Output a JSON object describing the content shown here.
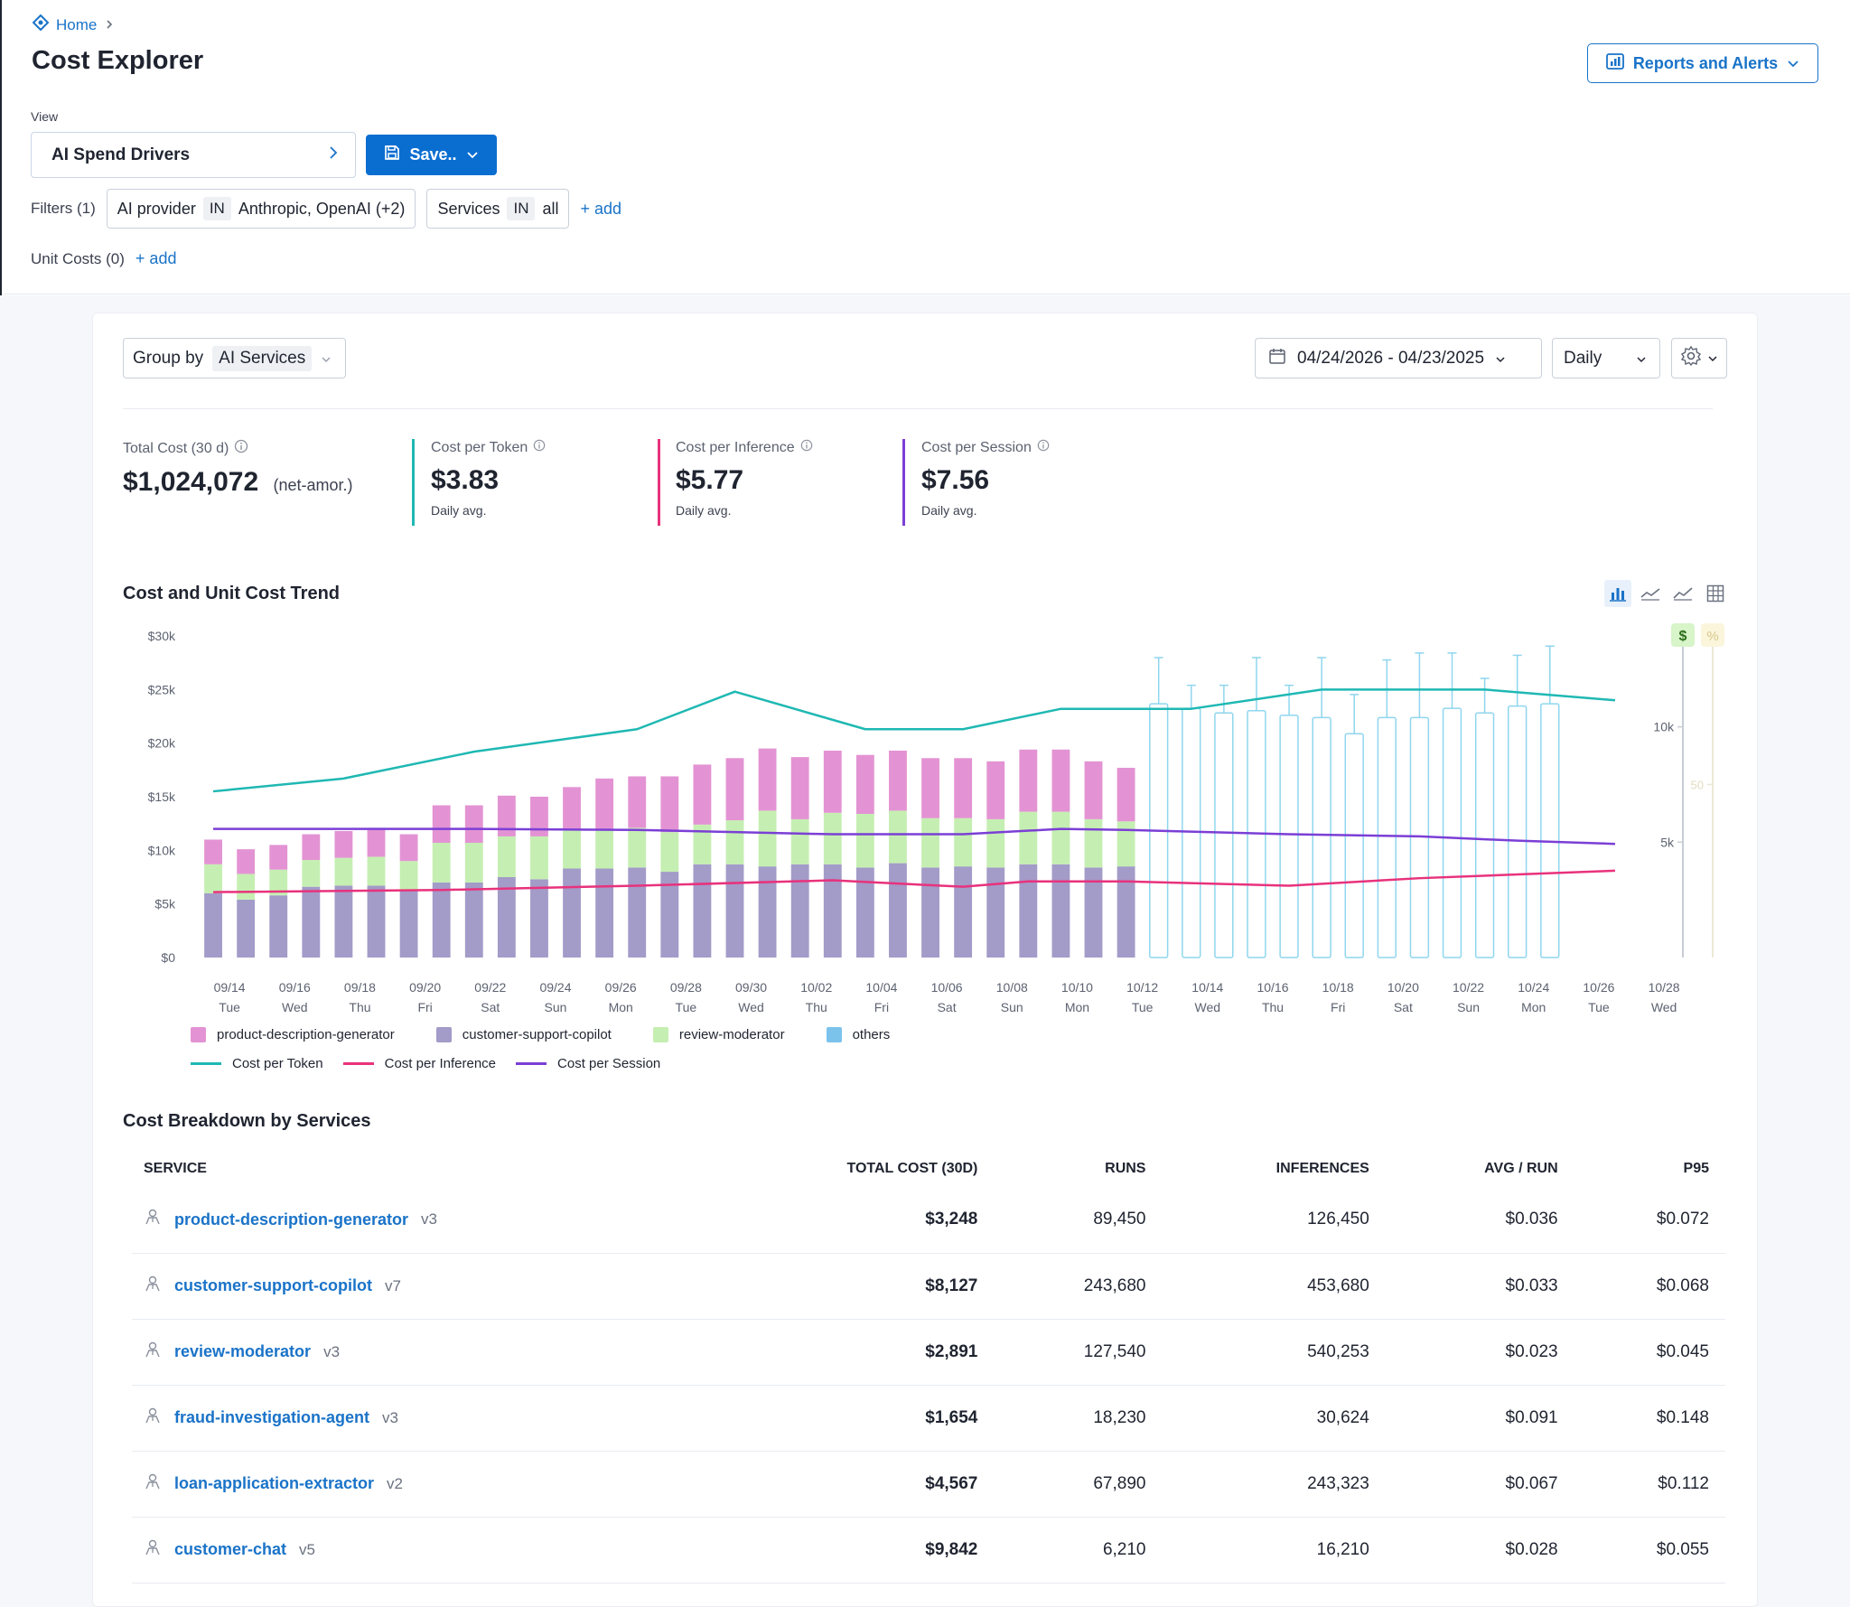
{
  "breadcrumb": {
    "home": "Home"
  },
  "page_title": "Cost Explorer",
  "reports_button": "Reports and Alerts",
  "view": {
    "label": "View",
    "selected": "AI Spend Drivers",
    "save_label": "Save.."
  },
  "filters": {
    "label": "Filters (1)",
    "chips": [
      {
        "field": "AI provider",
        "op": "IN",
        "value": "Anthropic, OpenAI (+2)"
      },
      {
        "field": "Services",
        "op": "IN",
        "value": "all"
      }
    ],
    "add_label": "+ add"
  },
  "unit_costs": {
    "label": "Unit Costs (0)",
    "add_label": "+ add"
  },
  "controls": {
    "group_by_label": "Group by",
    "group_by_value": "AI Services",
    "date_range": "04/24/2026 - 04/23/2025",
    "granularity": "Daily"
  },
  "kpis": [
    {
      "label": "Total Cost (30 d)",
      "value": "$1,024,072",
      "suffix": "(net-amor.)",
      "sub": "",
      "color": ""
    },
    {
      "label": "Cost per Token",
      "value": "$3.83",
      "suffix": "",
      "sub": "Daily avg.",
      "color": "#1fb8b3"
    },
    {
      "label": "Cost per Inference",
      "value": "$5.77",
      "suffix": "",
      "sub": "Daily avg.",
      "color": "#e8327c"
    },
    {
      "label": "Cost per Session",
      "value": "$7.56",
      "suffix": "",
      "sub": "Daily avg.",
      "color": "#7b3fd6"
    }
  ],
  "trend_title": "Cost and Unit Cost Trend",
  "chart_toggle": {
    "dollar": "$",
    "percent": "%"
  },
  "chart_data": {
    "type": "bar",
    "title": "Cost and Unit Cost Trend",
    "y_ticks": [
      "$0",
      "$5k",
      "$10k",
      "$15k",
      "$20k",
      "$25k",
      "$30k"
    ],
    "ylim": [
      0,
      30000
    ],
    "right_ticks": [
      "10k",
      "5k"
    ],
    "right_mid_tick": "50",
    "right_ylim": [
      0,
      13000
    ],
    "x_labels": [
      {
        "date": "09/14",
        "day": "Tue"
      },
      {
        "date": "09/16",
        "day": "Wed"
      },
      {
        "date": "09/18",
        "day": "Thu"
      },
      {
        "date": "09/20",
        "day": "Fri"
      },
      {
        "date": "09/22",
        "day": "Sat"
      },
      {
        "date": "09/24",
        "day": "Sun"
      },
      {
        "date": "09/26",
        "day": "Mon"
      },
      {
        "date": "09/28",
        "day": "Tue"
      },
      {
        "date": "09/30",
        "day": "Wed"
      },
      {
        "date": "10/02",
        "day": "Thu"
      },
      {
        "date": "10/04",
        "day": "Fri"
      },
      {
        "date": "10/06",
        "day": "Sat"
      },
      {
        "date": "10/08",
        "day": "Sun"
      },
      {
        "date": "10/10",
        "day": "Mon"
      },
      {
        "date": "10/12",
        "day": "Tue"
      },
      {
        "date": "10/14",
        "day": "Wed"
      },
      {
        "date": "10/16",
        "day": "Thu"
      },
      {
        "date": "10/18",
        "day": "Fri"
      },
      {
        "date": "10/20",
        "day": "Sat"
      },
      {
        "date": "10/22",
        "day": "Sun"
      },
      {
        "date": "10/24",
        "day": "Mon"
      },
      {
        "date": "10/26",
        "day": "Tue"
      },
      {
        "date": "10/28",
        "day": "Wed"
      }
    ],
    "stack_series": [
      {
        "name": "customer-support-copilot",
        "color": "#a39bc8",
        "values": [
          6000,
          5400,
          5800,
          6600,
          6700,
          6700,
          6300,
          7000,
          7000,
          7500,
          7300,
          8300,
          8300,
          8400,
          8000,
          8700,
          8700,
          8500,
          8700,
          8700,
          8400,
          8800,
          8400,
          8500,
          8400,
          8700,
          8700,
          8400,
          8500
        ]
      },
      {
        "name": "review-moderator",
        "color": "#c5efb2",
        "values": [
          2700,
          2400,
          2400,
          2500,
          2600,
          2700,
          2700,
          3700,
          3700,
          3800,
          4000,
          3600,
          3600,
          3700,
          3700,
          3700,
          4100,
          5200,
          4200,
          4800,
          5000,
          4900,
          4600,
          4500,
          4500,
          4900,
          4900,
          4500,
          4200
        ]
      },
      {
        "name": "product-description-generator",
        "color": "#e393d3",
        "values": [
          2300,
          2300,
          2300,
          2400,
          2500,
          2700,
          2500,
          3500,
          3500,
          3800,
          3700,
          4000,
          4800,
          4800,
          5200,
          5600,
          5800,
          5800,
          5800,
          5800,
          5500,
          5600,
          5600,
          5600,
          5400,
          5800,
          5800,
          5400,
          5000
        ]
      }
    ],
    "forecast_bars": [
      {
        "low": 11000,
        "high": 13000
      },
      {
        "low": 10800,
        "high": 11800
      },
      {
        "low": 10600,
        "high": 11800
      },
      {
        "low": 10700,
        "high": 13000
      },
      {
        "low": 10500,
        "high": 11800
      },
      {
        "low": 10400,
        "high": 13000
      },
      {
        "low": 9700,
        "high": 11400
      },
      {
        "low": 10400,
        "high": 12900
      },
      {
        "low": 10400,
        "high": 13200
      },
      {
        "low": 10800,
        "high": 13200
      },
      {
        "low": 10600,
        "high": 12100
      },
      {
        "low": 10900,
        "high": 13100
      },
      {
        "low": 11000,
        "high": 13500
      }
    ],
    "line_series": [
      {
        "name": "Cost per Token",
        "color": "#1fb8b3",
        "points": [
          [
            0,
            15500
          ],
          [
            4,
            16700
          ],
          [
            8,
            19200
          ],
          [
            13,
            21300
          ],
          [
            16,
            24800
          ],
          [
            20,
            21300
          ],
          [
            23,
            21300
          ],
          [
            26,
            23200
          ],
          [
            28,
            23200
          ],
          [
            30,
            23200
          ],
          [
            34,
            25000
          ],
          [
            36,
            25000
          ],
          [
            39,
            25000
          ],
          [
            43,
            24000
          ]
        ]
      },
      {
        "name": "Cost per Inference",
        "color": "#e8327c",
        "points": [
          [
            0,
            6100
          ],
          [
            7,
            6300
          ],
          [
            13,
            6700
          ],
          [
            19,
            7200
          ],
          [
            21,
            6900
          ],
          [
            23,
            6600
          ],
          [
            25,
            7100
          ],
          [
            28,
            7100
          ],
          [
            33,
            6700
          ],
          [
            37,
            7400
          ],
          [
            43,
            8100
          ]
        ]
      },
      {
        "name": "Cost per Session",
        "color": "#7b3fd6",
        "points": [
          [
            0,
            12000
          ],
          [
            8,
            12000
          ],
          [
            13,
            11900
          ],
          [
            19,
            11500
          ],
          [
            21,
            11500
          ],
          [
            23,
            11500
          ],
          [
            26,
            12000
          ],
          [
            28,
            11900
          ],
          [
            33,
            11500
          ],
          [
            37,
            11300
          ],
          [
            40,
            10900
          ],
          [
            43,
            10600
          ]
        ]
      }
    ],
    "legend": [
      {
        "label": "product-description-generator",
        "color": "#e393d3",
        "kind": "box"
      },
      {
        "label": "customer-support-copilot",
        "color": "#a39bc8",
        "kind": "box"
      },
      {
        "label": "review-moderator",
        "color": "#c5efb2",
        "kind": "box"
      },
      {
        "label": "others",
        "color": "#7cc3ec",
        "kind": "box"
      },
      {
        "label": "Cost per Token",
        "color": "#1fb8b3",
        "kind": "line"
      },
      {
        "label": "Cost per Inference",
        "color": "#e8327c",
        "kind": "line"
      },
      {
        "label": "Cost per Session",
        "color": "#7b3fd6",
        "kind": "line"
      }
    ]
  },
  "breakdown": {
    "title": "Cost Breakdown by Services",
    "columns": [
      "SERVICE",
      "TOTAL COST (30D)",
      "RUNS",
      "INFERENCES",
      "AVG / RUN",
      "P95"
    ],
    "rows": [
      {
        "name": "product-description-generator",
        "version": "v3",
        "cost": "$3,248",
        "runs": "89,450",
        "inferences": "126,450",
        "avg": "$0.036",
        "p95": "$0.072"
      },
      {
        "name": "customer-support-copilot",
        "version": "v7",
        "cost": "$8,127",
        "runs": "243,680",
        "inferences": "453,680",
        "avg": "$0.033",
        "p95": "$0.068"
      },
      {
        "name": "review-moderator",
        "version": "v3",
        "cost": "$2,891",
        "runs": "127,540",
        "inferences": "540,253",
        "avg": "$0.023",
        "p95": "$0.045"
      },
      {
        "name": "fraud-investigation-agent",
        "version": "v3",
        "cost": "$1,654",
        "runs": "18,230",
        "inferences": "30,624",
        "avg": "$0.091",
        "p95": "$0.148"
      },
      {
        "name": "loan-application-extractor",
        "version": "v2",
        "cost": "$4,567",
        "runs": "67,890",
        "inferences": "243,323",
        "avg": "$0.067",
        "p95": "$0.112"
      },
      {
        "name": "customer-chat",
        "version": "v5",
        "cost": "$9,842",
        "runs": "6,210",
        "inferences": "16,210",
        "avg": "$0.028",
        "p95": "$0.055"
      }
    ]
  }
}
